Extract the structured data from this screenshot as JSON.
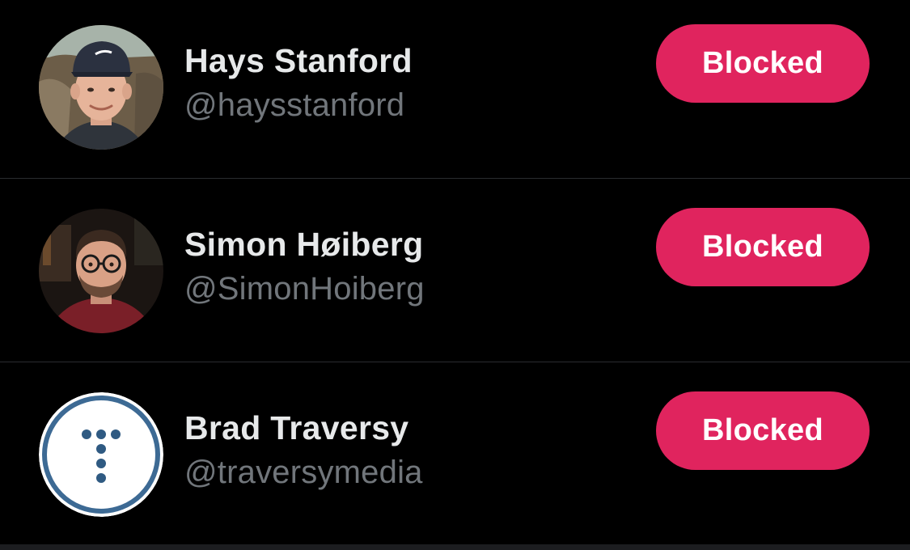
{
  "accent_color": "#e0245e",
  "blocked_accounts": [
    {
      "display_name": "Hays Stanford",
      "handle": "@haysstanford",
      "button_label": "Blocked",
      "avatar_icon": "user-photo"
    },
    {
      "display_name": "Simon Høiberg",
      "handle": "@SimonHoiberg",
      "button_label": "Blocked",
      "avatar_icon": "user-photo"
    },
    {
      "display_name": "Brad Traversy",
      "handle": "@traversymedia",
      "button_label": "Blocked",
      "avatar_icon": "traversy-logo"
    }
  ]
}
